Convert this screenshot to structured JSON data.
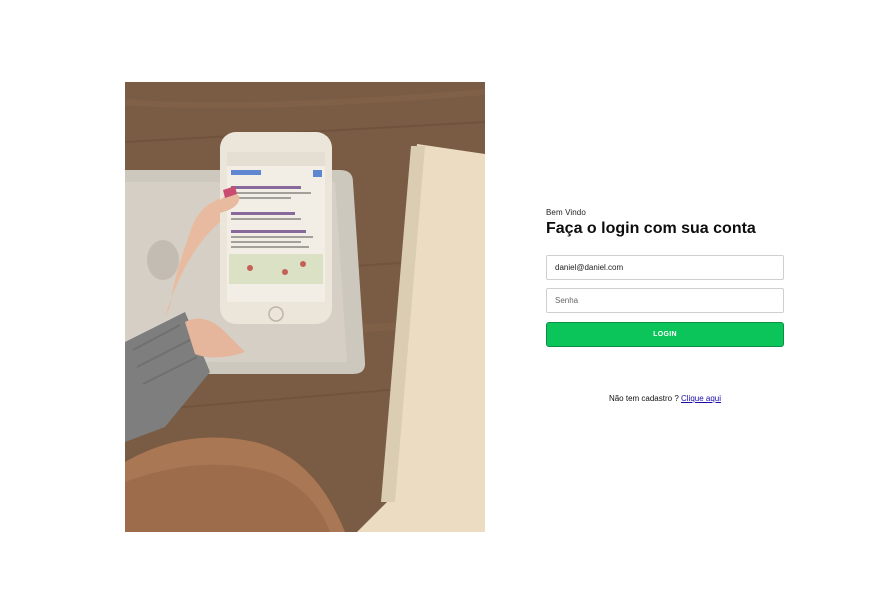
{
  "login": {
    "welcome": "Bem Vindo",
    "title": "Faça o login com sua conta",
    "email_value": "daniel@daniel.com",
    "password_placeholder": "Senha",
    "button_label": "LOGIN"
  },
  "signup": {
    "prompt": "Não tem cadastro ?",
    "link": "Clique aqui"
  },
  "colors": {
    "button": "#0bc45a",
    "link": "#1a0dab"
  }
}
